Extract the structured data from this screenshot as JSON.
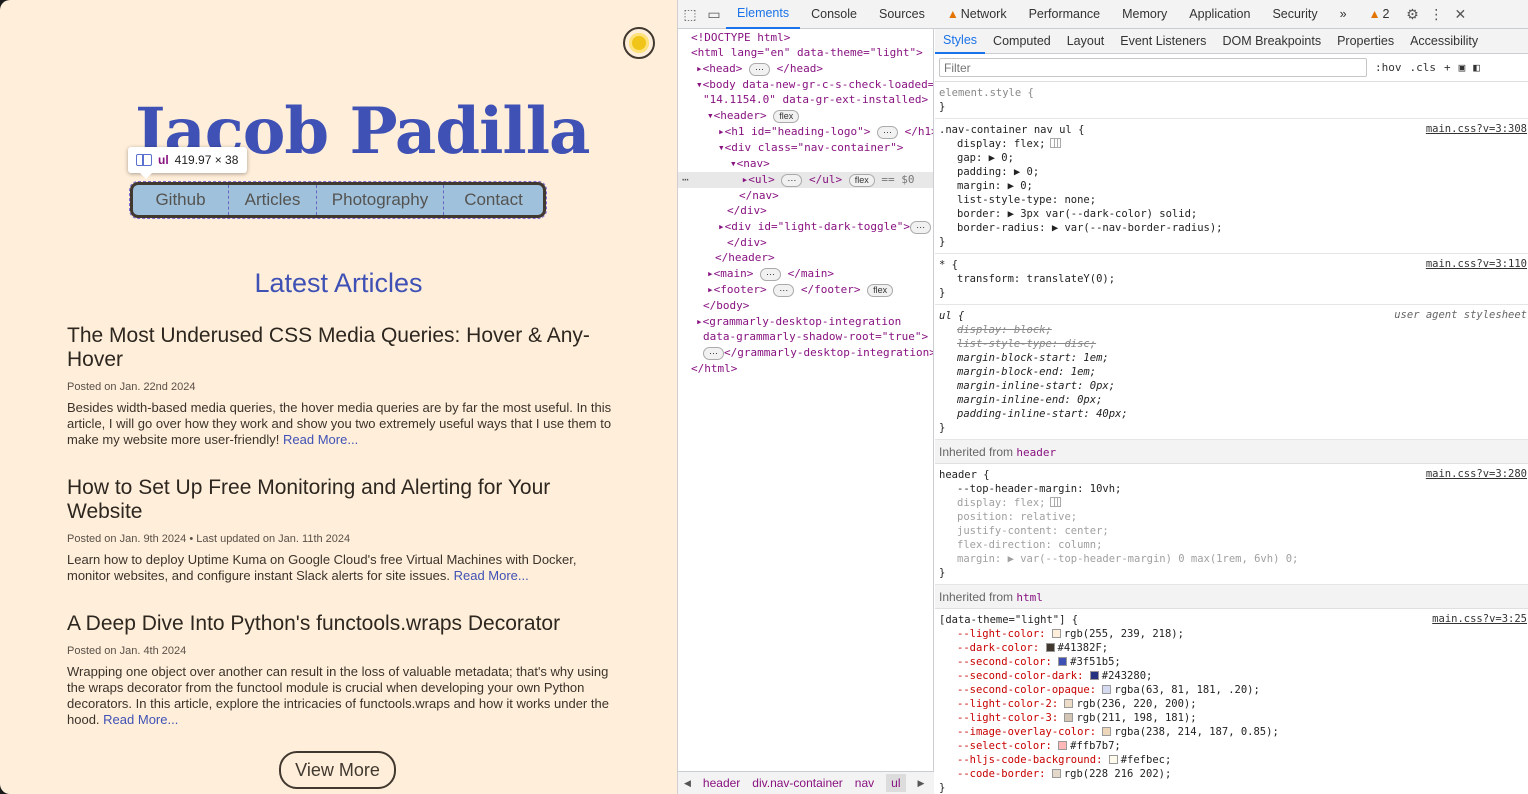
{
  "site": {
    "logo": "Jacob Padilla",
    "tooltip": {
      "tag": "ul",
      "size": "419.97 × 38"
    },
    "nav": [
      "Github",
      "Articles",
      "Photography",
      "Contact"
    ],
    "latest_heading": "Latest Articles",
    "articles": [
      {
        "title": "The Most Underused CSS Media Queries: Hover & Any-Hover",
        "meta": "Posted on Jan. 22nd 2024",
        "body": "Besides width-based media queries, the hover media queries are by far the most useful. In this article, I will go over how they work and show you two extremely useful ways that I use them to make my website more user-friendly!",
        "more": "Read More..."
      },
      {
        "title": "How to Set Up Free Monitoring and Alerting for Your Website",
        "meta": "Posted on Jan. 9th 2024 • Last updated on Jan. 11th 2024",
        "body": "Learn how to deploy Uptime Kuma on Google Cloud's free Virtual Machines with Docker, monitor websites, and configure instant Slack alerts for site issues.",
        "more": "Read More..."
      },
      {
        "title": "A Deep Dive Into Python's functools.wraps Decorator",
        "meta": "Posted on Jan. 4th 2024",
        "body": "Wrapping one object over another can result in the loss of valuable metadata; that's why using the wraps decorator from the functool module is crucial when developing your own Python decorators. In this article, explore the intricacies of functools.wraps and how it works under the hood.",
        "more": "Read More..."
      }
    ],
    "view_more": "View More"
  },
  "devtools": {
    "tabs": [
      "Elements",
      "Console",
      "Sources",
      "Network",
      "Performance",
      "Memory",
      "Application",
      "Security"
    ],
    "more_tabs": "»",
    "warnings": "2",
    "styles_tabs": [
      "Styles",
      "Computed",
      "Layout",
      "Event Listeners",
      "DOM Breakpoints",
      "Properties",
      "Accessibility"
    ],
    "filter_placeholder": "Filter",
    "hov": ":hov",
    "cls": ".cls",
    "dom": [
      "<!DOCTYPE html>",
      "<html lang=\"en\" data-theme=\"light\">",
      "<head>",
      "</head>",
      "<body data-new-gr-c-s-check-loaded=",
      "\"14.1154.0\" data-gr-ext-installed>",
      "<header>",
      "<h1 id=\"heading-logo\">",
      "</h1>",
      "<div class=\"nav-container\">",
      "<nav>",
      "<ul>",
      "</ul>",
      "== $0",
      "</nav>",
      "</div>",
      "<div id=\"light-dark-toggle\">",
      "</div>",
      "</header>",
      "<main>",
      "</main>",
      "<footer>",
      "</footer>",
      "</body>",
      "<grammarly-desktop-integration",
      "data-grammarly-shadow-root=\"true\">",
      "</grammarly-desktop-integration>",
      "</html>"
    ],
    "flex_badge": "flex",
    "crumbs": [
      "header",
      "div.nav-container",
      "nav",
      "ul"
    ],
    "rules": {
      "element_style": "element.style {",
      "nav": {
        "selector": ".nav-container nav ul {",
        "src": "main.css?v=3:308",
        "decls": [
          "display: flex;",
          "gap: ▶ 0;",
          "padding: ▶ 0;",
          "margin: ▶ 0;",
          "list-style-type: none;",
          "border: ▶ 3px var(--dark-color) solid;",
          "border-radius: ▶ var(--nav-border-radius);"
        ]
      },
      "star": {
        "selector": "* {",
        "src": "main.css?v=3:110",
        "decls": [
          "transform: translateY(0);"
        ]
      },
      "ua": {
        "selector": "ul {",
        "src": "user agent stylesheet",
        "decls": [
          "display: block;",
          "list-style-type: disc;",
          "margin-block-start: 1em;",
          "margin-block-end: 1em;",
          "margin-inline-start: 0px;",
          "margin-inline-end: 0px;",
          "padding-inline-start: 40px;"
        ]
      },
      "inherited_header_label": "Inherited from",
      "inherited_header_tag": "header",
      "header": {
        "selector": "header {",
        "src": "main.css?v=3:280",
        "decls": [
          "--top-header-margin: 10vh;",
          "display: flex;",
          "position: relative;",
          "justify-content: center;",
          "flex-direction: column;",
          "margin: ▶ var(--top-header-margin) 0 max(1rem, 6vh) 0;"
        ]
      },
      "inherited_html_label": "Inherited from",
      "inherited_html_tag": "html",
      "theme": {
        "selector": "[data-theme=\"light\"] {",
        "src": "main.css?v=3:25",
        "decls": [
          "--light-color: rgb(255, 239, 218);",
          "--dark-color: #41382F;",
          "--second-color: #3f51b5;",
          "--second-color-dark: #243280;",
          "--second-color-opaque: rgba(63, 81, 181, .20);",
          "--light-color-2: rgb(236, 220, 200);",
          "--light-color-3: rgb(211, 198, 181);",
          "--image-overlay-color: rgba(238, 214, 187, 0.85);",
          "--select-color: #ffb7b7;",
          "--hljs-code-background: #fefbec;",
          "--code-border: rgb(228 216 202);"
        ],
        "swatches": [
          "#ffefda",
          "#41382f",
          "#3f51b5",
          "#243280",
          "#d6daf0",
          "#ecdcc8",
          "#d3c6b5",
          "#eed6bb",
          "#ffb7b7",
          "#fefbec",
          "#e4d8ca"
        ]
      },
      "close_brace": "}"
    }
  },
  "colors": {
    "accent": "#3f51b5",
    "dark": "#41382f",
    "light": "#ffefda",
    "devtools_blue": "#1a73e8"
  }
}
